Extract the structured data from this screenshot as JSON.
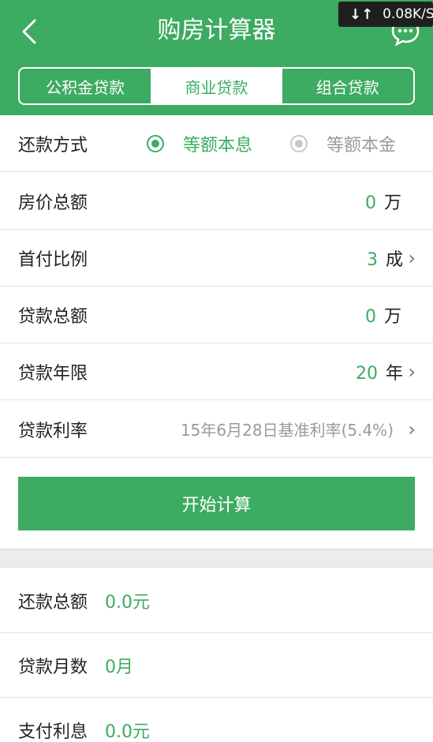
{
  "header": {
    "title": "购房计算器",
    "network_speed": "0.08K/S",
    "network_arrows": "↓↑"
  },
  "tabs": [
    {
      "label": "公积金贷款",
      "active": false
    },
    {
      "label": "商业贷款",
      "active": true
    },
    {
      "label": "组合贷款",
      "active": false
    }
  ],
  "form": {
    "repay_method": {
      "label": "还款方式",
      "options": [
        {
          "label": "等额本息",
          "selected": true
        },
        {
          "label": "等额本金",
          "selected": false
        }
      ]
    },
    "house_price": {
      "label": "房价总额",
      "value": "0",
      "unit": "万"
    },
    "down_payment": {
      "label": "首付比例",
      "value": "3",
      "unit": "成"
    },
    "loan_total": {
      "label": "贷款总额",
      "value": "0",
      "unit": "万"
    },
    "loan_years": {
      "label": "贷款年限",
      "value": "20",
      "unit": "年"
    },
    "loan_rate": {
      "label": "贷款利率",
      "value": "15年6月28日基准利率(5.4%)"
    }
  },
  "calc_button": "开始计算",
  "results": [
    {
      "label": "还款总额",
      "value": "0.0元"
    },
    {
      "label": "贷款月数",
      "value": "0月"
    },
    {
      "label": "支付利息",
      "value": "0.0元"
    }
  ],
  "colors": {
    "accent": "#3dab61"
  }
}
